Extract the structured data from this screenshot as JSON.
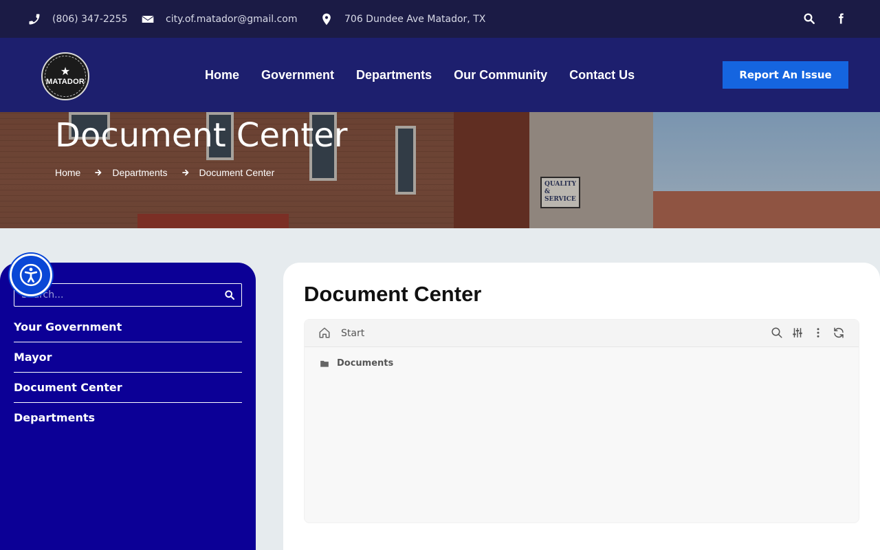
{
  "topbar": {
    "phone": "(806) 347-2255",
    "email": "city.of.matador@gmail.com",
    "address": "706 Dundee Ave Matador, TX",
    "icons": [
      "phone-icon",
      "envelope-icon",
      "map-pin-icon",
      "search-icon",
      "facebook-icon"
    ]
  },
  "navbar": {
    "logo_text": "MATADOR",
    "links": [
      "Home",
      "Government",
      "Departments",
      "Our Community",
      "Contact Us"
    ],
    "cta_label": "Report An Issue",
    "cta_color": "#1565e0",
    "background": "#1d1f6e"
  },
  "hero": {
    "title": "Document Center",
    "breadcrumb": [
      "Home",
      "Departments",
      "Document Center"
    ],
    "sign_text": "QUALITY & SERVICE"
  },
  "sidebar": {
    "search_placeholder": "Search...",
    "items": [
      "Your Government",
      "Mayor",
      "Document Center",
      "Departments"
    ],
    "background": "#0c0096"
  },
  "main": {
    "title": "Document Center",
    "file_manager": {
      "start_label": "Start",
      "tools": [
        "search-icon",
        "filter-sliders-icon",
        "more-vertical-icon",
        "refresh-icon"
      ],
      "rows": [
        {
          "icon": "folder-icon",
          "label": "Documents"
        }
      ]
    }
  }
}
